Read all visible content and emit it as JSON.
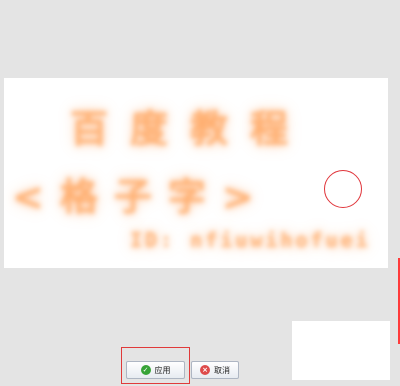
{
  "preview": {
    "line1": "百度教程",
    "line2": "<格子字>",
    "line3": "ID: nfiuwihofuei"
  },
  "buttons": {
    "apply_label": "应用",
    "cancel_label": "取消"
  },
  "icons": {
    "apply": "check-icon",
    "cancel": "close-icon"
  },
  "colors": {
    "text_glow": "#ffb07a",
    "highlight": "#e03a3a",
    "apply_icon": "#37a337",
    "cancel_icon": "#de4b4b"
  }
}
